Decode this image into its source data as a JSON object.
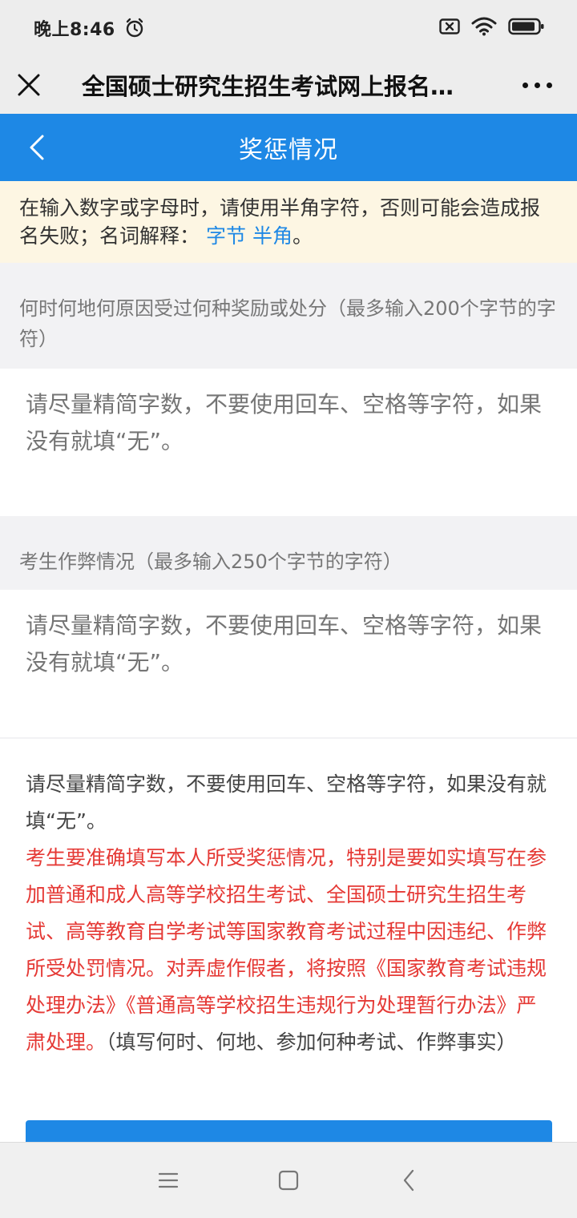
{
  "status_bar": {
    "time": "晚上8:46",
    "icons": [
      "alarm-icon",
      "sim-off-icon",
      "wifi-icon",
      "battery-icon"
    ]
  },
  "title_bar": {
    "title": "全国硕士研究生招生考试网上报名…",
    "close_icon": "close-icon",
    "more_icon": "more-icon"
  },
  "header": {
    "title": "奖惩情况",
    "back_icon": "chevron-left-icon",
    "background": "#1e88e5"
  },
  "notice": {
    "text": "在输入数字或字母时，请使用半角字符，否则可能会造成报名失败；名词解释：",
    "link_byte": "字节",
    "link_halfwidth": "半角",
    "suffix": "。",
    "background": "#fdf6e3"
  },
  "fields": {
    "rewards": {
      "label": "何时何地何原因受过何种奖励或处分（最多输入200个字节的字符）",
      "placeholder": "请尽量精简字数，不要使用回车、空格等字符，如果没有就填“无”。"
    },
    "cheating": {
      "label": "考生作弊情况（最多输入250个字节的字符）",
      "placeholder": "请尽量精简字数，不要使用回车、空格等字符，如果没有就填“无”。"
    }
  },
  "instructions": {
    "gray": "请尽量精简字数，不要使用回车、空格等字符，如果没有就填“无”。",
    "red": "考生要准确填写本人所受奖惩情况，特别是要如实填写在参加普通和成人高等学校招生考试、全国硕士研究生招生考试、高等教育自学考试等国家教育考试过程中因违纪、作弊所受处罚情况。对弄虚作假者，将按照《国家教育考试违规处理办法》《普通高等学校招生违规行为处理暂行办法》严肃处理。",
    "tail": "（填写何时、何地、参加何种考试、作弊事实）",
    "red_color": "#e53935"
  },
  "nav": {
    "icons": [
      "menu-icon",
      "home-icon",
      "back-icon"
    ]
  }
}
